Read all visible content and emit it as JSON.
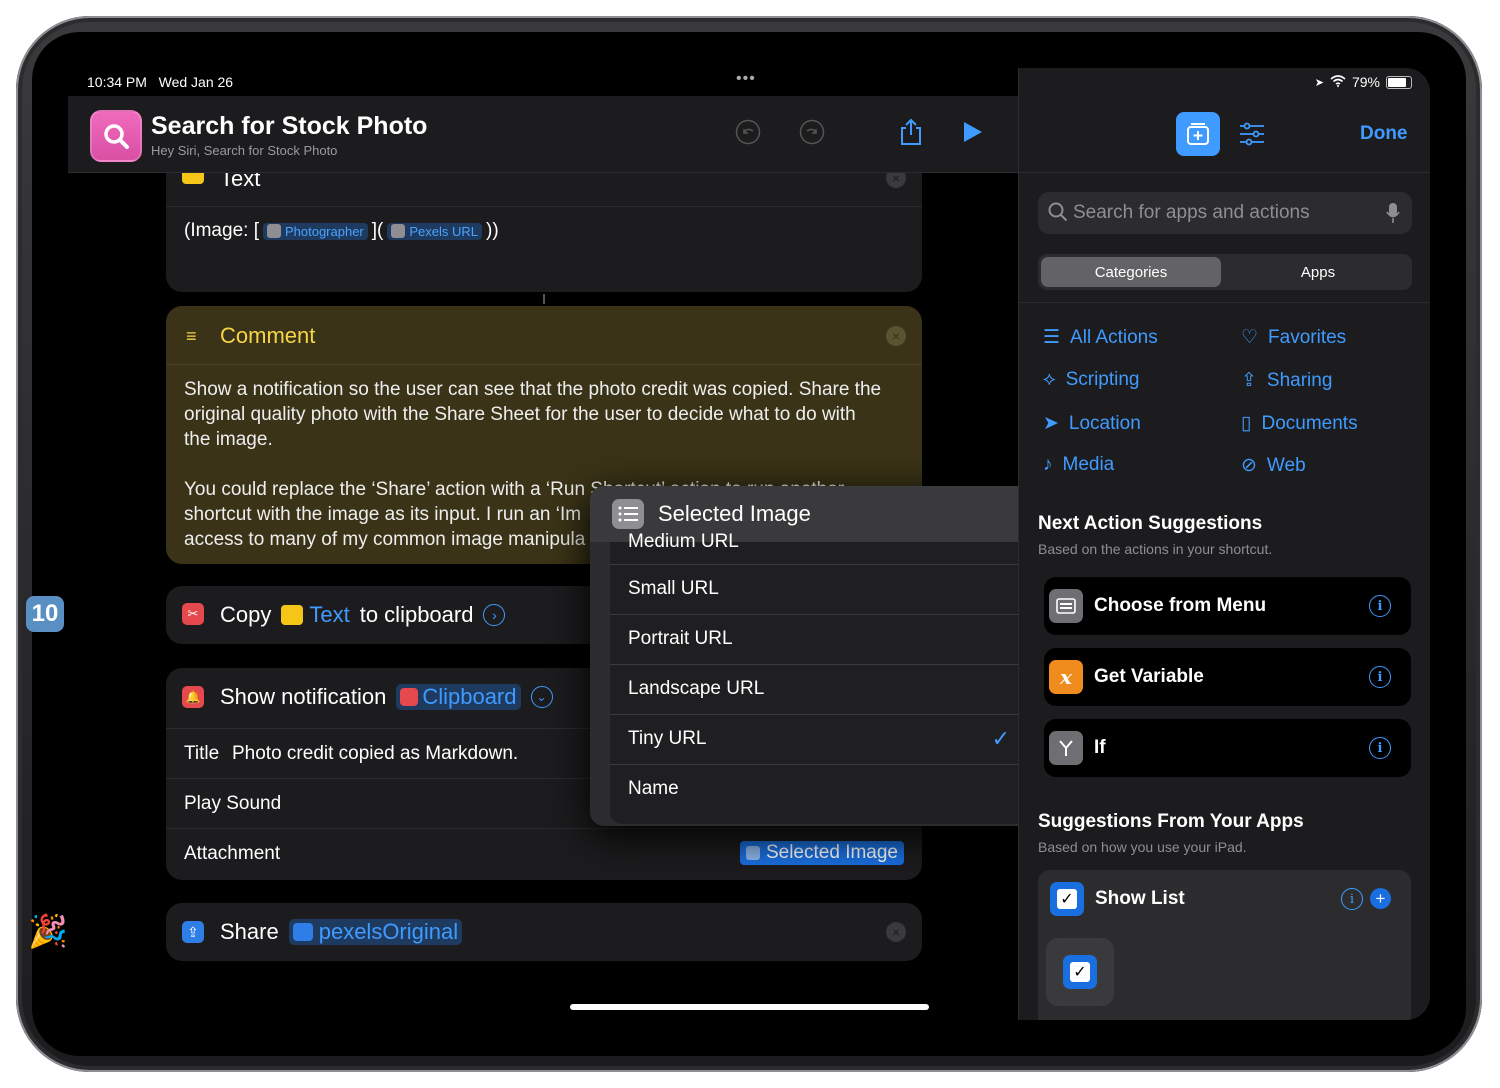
{
  "status": {
    "time": "10:34 PM",
    "date": "Wed Jan 26",
    "dots": "•••",
    "battery": "79%"
  },
  "header": {
    "title": "Search for Stock Photo",
    "subtitle": "Hey Siri, Search for Stock Photo",
    "done": "Done"
  },
  "text_card": {
    "label": "Text",
    "prefix": "(Image: [",
    "token1": "Photographer",
    "mid": "](",
    "token2": "Pexels URL",
    "suffix": "))"
  },
  "comment_card": {
    "label": "Comment",
    "line1": "Show a notification so the user can see that the photo credit was copied. Share the",
    "line2": "original quality photo with the Share Sheet for the user to decide what to do with",
    "line3": "the image.",
    "line4": "You could replace the ‘Share’ action with a ‘Run Shortcut’ action to run another",
    "line5": "shortcut with the image as its input. I run an ‘Im",
    "line6": "access to many of my common image manipula"
  },
  "copy_card": {
    "copy": "Copy",
    "token": "Text",
    "suffix": "to clipboard"
  },
  "notify_card": {
    "label": "Show notification",
    "token": "Clipboard",
    "title_label": "Title",
    "title_value": "Photo credit copied as Markdown.",
    "sound_label": "Play Sound",
    "attach_label": "Attachment",
    "attach_token": "Selected Image"
  },
  "share_card": {
    "label": "Share",
    "token": "pexelsOriginal"
  },
  "popup": {
    "title": "Selected Image",
    "items": [
      "Medium URL",
      "Small URL",
      "Portrait URL",
      "Landscape URL",
      "Tiny URL",
      "Name"
    ],
    "checked": "Tiny URL",
    "checkmark": "✓"
  },
  "sidebar": {
    "search_placeholder": "Search for apps and actions",
    "seg_categories": "Categories",
    "seg_apps": "Apps",
    "categories": [
      "All Actions",
      "Favorites",
      "Scripting",
      "Sharing",
      "Location",
      "Documents",
      "Media",
      "Web"
    ],
    "next_title": "Next Action Suggestions",
    "next_sub": "Based on the actions in your shortcut.",
    "suggestions": [
      "Choose from Menu",
      "Get Variable",
      "If"
    ],
    "apps_title": "Suggestions From Your Apps",
    "apps_sub": "Based on how you use your iPad.",
    "app_item": "Show List"
  },
  "dock_badge": "10",
  "colors": {
    "accent": "#3f9bff",
    "comment_bg": "#3a3317",
    "comment_text": "#f5d547"
  }
}
